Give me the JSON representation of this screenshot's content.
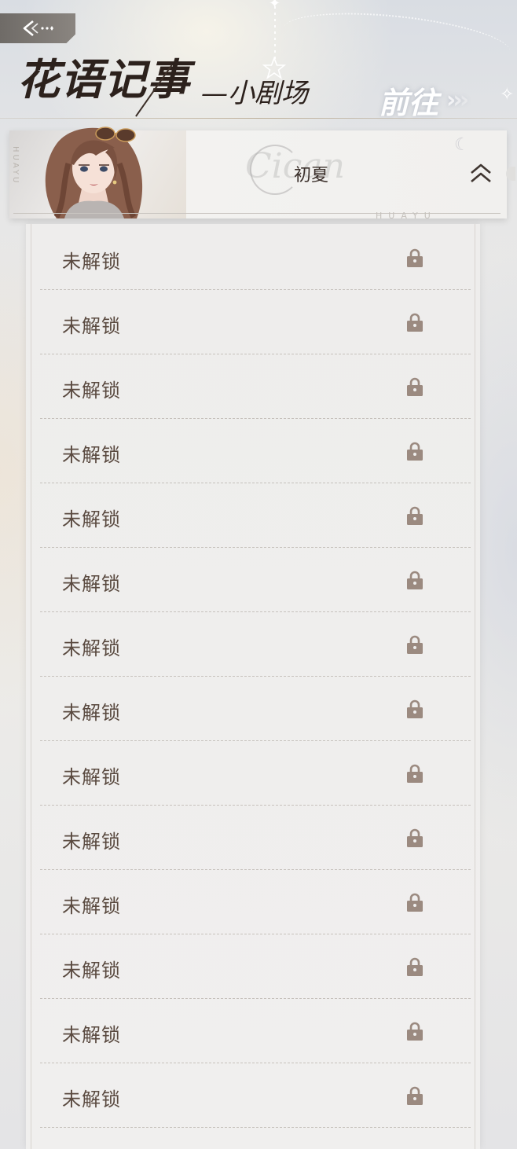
{
  "header": {
    "title": "花语记事",
    "subtitle": "—小剧场",
    "goto_label": "前往",
    "goto_arrows": [
      "›",
      "›",
      "›"
    ]
  },
  "character": {
    "name": "初夏",
    "script_deco": "Cican",
    "side_text": "HUAYU",
    "caption": "HUAYU"
  },
  "icons": {
    "back": "back-arrow-icon",
    "collapse": "double-chevron-up-icon",
    "lock": "lock-icon"
  },
  "colors": {
    "title": "#2c211c",
    "row_text": "#5a4a40",
    "lock": "#9b8a80"
  },
  "stories": [
    {
      "label": "未解锁",
      "locked": true
    },
    {
      "label": "未解锁",
      "locked": true
    },
    {
      "label": "未解锁",
      "locked": true
    },
    {
      "label": "未解锁",
      "locked": true
    },
    {
      "label": "未解锁",
      "locked": true
    },
    {
      "label": "未解锁",
      "locked": true
    },
    {
      "label": "未解锁",
      "locked": true
    },
    {
      "label": "未解锁",
      "locked": true
    },
    {
      "label": "未解锁",
      "locked": true
    },
    {
      "label": "未解锁",
      "locked": true
    },
    {
      "label": "未解锁",
      "locked": true
    },
    {
      "label": "未解锁",
      "locked": true
    },
    {
      "label": "未解锁",
      "locked": true
    },
    {
      "label": "未解锁",
      "locked": true
    }
  ]
}
